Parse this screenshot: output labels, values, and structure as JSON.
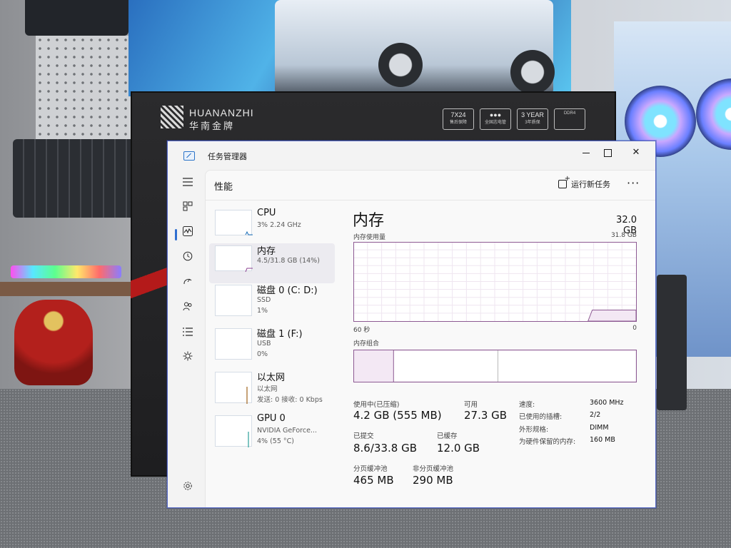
{
  "background": {
    "box_brand": "HUANANZHI",
    "box_brand_cn": "华南金牌",
    "badges": [
      {
        "main": "7X24",
        "sub": "售后保障"
      },
      {
        "main": "●●●",
        "sub": "全国志电管"
      },
      {
        "main": "3 YEAR",
        "sub": "3年质保"
      },
      {
        "main": "",
        "sub": "DDR4"
      }
    ]
  },
  "window": {
    "title": "任务管理器",
    "buttons": {
      "minimize": "",
      "maximize": "",
      "close": "✕"
    }
  },
  "nav": {
    "icons": [
      "hamburger-icon",
      "processes-icon",
      "performance-icon",
      "history-icon",
      "startup-icon",
      "users-icon",
      "details-icon",
      "services-icon",
      "settings-icon"
    ],
    "active": "performance-icon"
  },
  "header": {
    "title": "性能",
    "run_new_task": "运行新任务",
    "more": "···"
  },
  "devices": [
    {
      "name": "CPU",
      "line1": "3% 2.24 GHz",
      "line2": "",
      "selected": false
    },
    {
      "name": "内存",
      "line1": "4.5/31.8 GB (14%)",
      "line2": "",
      "selected": true
    },
    {
      "name": "磁盘 0 (C: D:)",
      "line1": "SSD",
      "line2": "1%",
      "selected": false
    },
    {
      "name": "磁盘 1 (F:)",
      "line1": "USB",
      "line2": "0%",
      "selected": false
    },
    {
      "name": "以太网",
      "line1": "以太网",
      "line2": "发送: 0 接收: 0 Kbps",
      "selected": false
    },
    {
      "name": "GPU 0",
      "line1": "NVIDIA GeForce...",
      "line2": "4% (55 °C)",
      "selected": false
    }
  ],
  "memory": {
    "title": "内存",
    "total": "32.0 GB",
    "usage_label": "内存使用量",
    "usage_max": "31.8 GB",
    "axis_left": "60 秒",
    "axis_right": "0",
    "composition_label": "内存组合",
    "composition_fractions": [
      0.14,
      0.37,
      0.49
    ],
    "usage_level_fraction": 0.14,
    "stats": {
      "in_use_label": "使用中(已压缩)",
      "in_use_value": "4.2 GB (555 MB)",
      "available_label": "可用",
      "available_value": "27.3 GB",
      "committed_label": "已提交",
      "committed_value": "8.6/33.8 GB",
      "cached_label": "已缓存",
      "cached_value": "12.0 GB",
      "paged_label": "分页缓冲池",
      "paged_value": "465 MB",
      "nonpaged_label": "非分页缓冲池",
      "nonpaged_value": "290 MB"
    },
    "specs": {
      "speed_label": "速度:",
      "speed_value": "3600 MHz",
      "slots_label": "已使用的插槽:",
      "slots_value": "2/2",
      "form_label": "外形规格:",
      "form_value": "DIMM",
      "reserved_label": "为硬件保留的内存:",
      "reserved_value": "160 MB"
    }
  }
}
